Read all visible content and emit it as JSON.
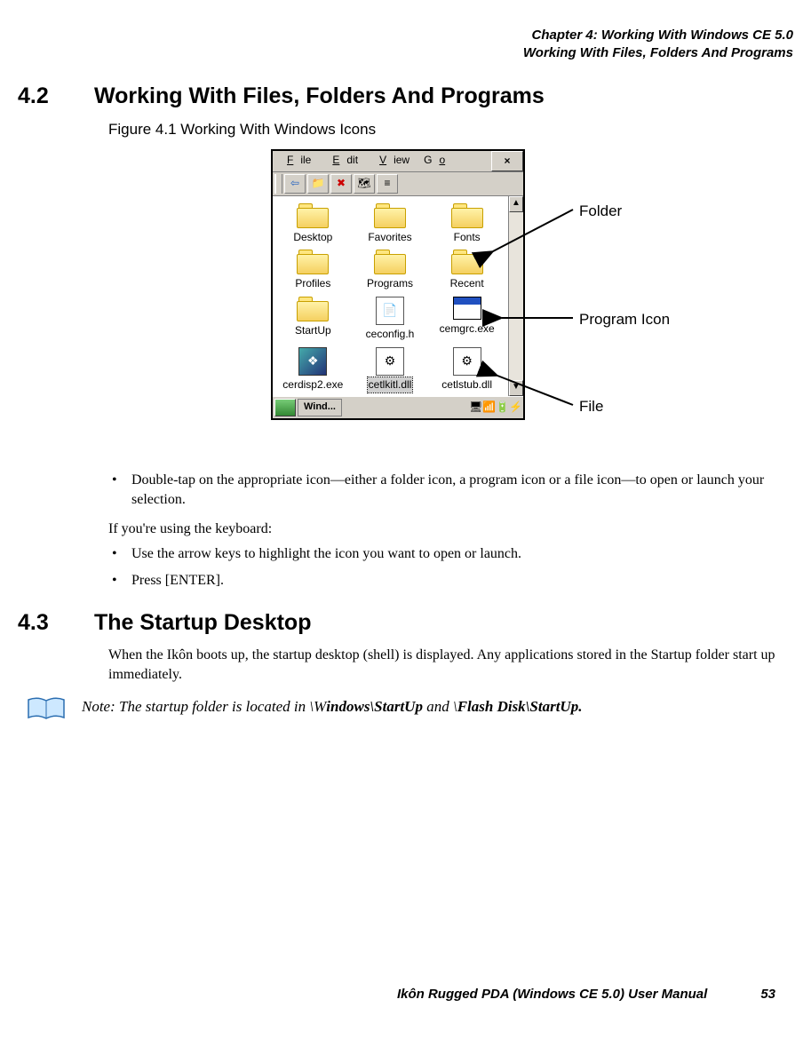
{
  "header": {
    "line1": "Chapter 4: Working With Windows CE 5.0",
    "line2": "Working With Files, Folders And Programs"
  },
  "sec42": {
    "num": "4.2",
    "title": "Working With Files, Folders And Programs"
  },
  "figcap": "Figure 4.1  Working With Windows Icons",
  "menu": {
    "file": "File",
    "edit": "Edit",
    "view": "View",
    "go": "Go",
    "close": "×"
  },
  "toolbar": {
    "back": "⇦",
    "up": "📁",
    "xred": "✖",
    "map": "🗺",
    "list": "≡"
  },
  "icons": {
    "desktop": "Desktop",
    "favorites": "Favorites",
    "fonts": "Fonts",
    "profiles": "Profiles",
    "programs": "Programs",
    "recent": "Recent",
    "startup": "StartUp",
    "ceconfig": "ceconfig.h",
    "cemgrc": "cemgrc.exe",
    "cerdisp": "cerdisp2.exe",
    "cetlkitl": "cetlkitl.dll",
    "cetlstub": "cetlstub.dll"
  },
  "taskbar": {
    "task": "Wind...",
    "up": "▲",
    "dn": "▼"
  },
  "callouts": {
    "folder": "Folder",
    "program": "Program Icon",
    "file": "File"
  },
  "para": {
    "b1": "Double-tap on the appropriate icon—either a folder icon, a program icon or a file icon—to open or launch your selection.",
    "kb": "If you're using the keyboard:",
    "b2": "Use the arrow keys to highlight the icon you want to open or launch.",
    "b3": "Press [ENTER]."
  },
  "sec43": {
    "num": "4.3",
    "title": "The Startup Desktop"
  },
  "para43": "When the Ikôn boots up, the startup desktop (shell) is displayed. Any applications stored in the Startup folder start up immediately.",
  "note": {
    "prefix": "Note: The startup folder is located in \\W",
    "bold1": "indows\\StartUp",
    "mid": " and \\",
    "bold2": "Flash Disk\\StartUp.",
    "suffix": ""
  },
  "footer": {
    "manual": "Ikôn Rugged PDA (Windows CE 5.0) User Manual",
    "page": "53"
  }
}
